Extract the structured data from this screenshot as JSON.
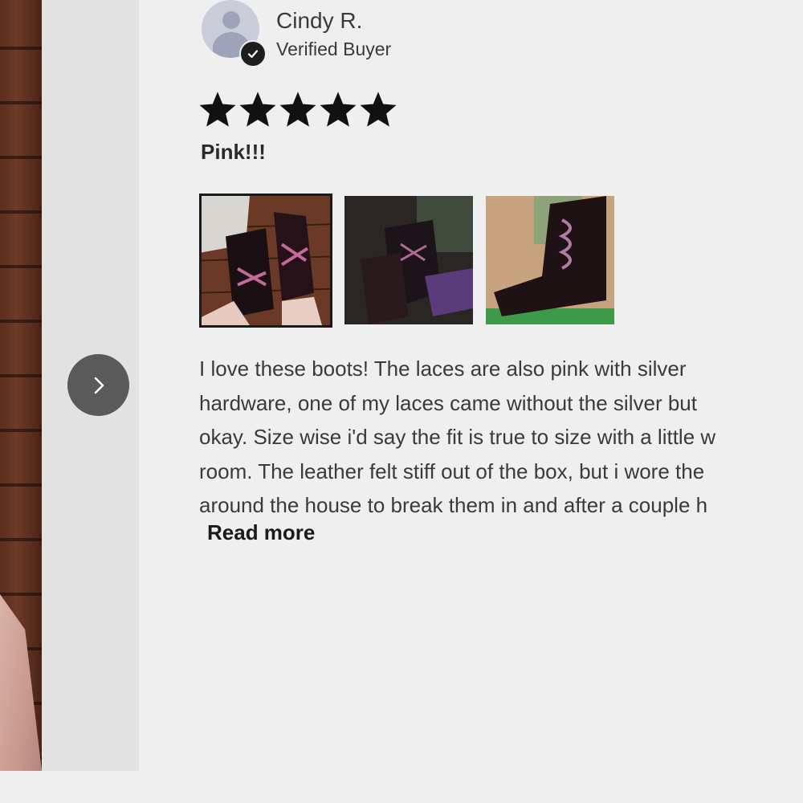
{
  "reviewer": {
    "name": "Cindy R.",
    "badge": "Verified Buyer",
    "avatar_icon": "user-avatar-icon",
    "badge_icon": "checkmark-icon"
  },
  "review": {
    "rating": 5,
    "rating_max": 5,
    "title": "Pink!!!",
    "body_lines": [
      "I love these boots! The laces are also pink with silver",
      "hardware, one of my laces came without the silver but",
      "okay. Size wise i'd say the fit is true to size with a little w",
      "room. The leather felt stiff out of the box, but i wore the",
      "around the house to break them in and after a couple h"
    ],
    "read_more": "Read more"
  },
  "carousel": {
    "next_icon": "chevron-right-icon"
  },
  "colors": {
    "background": "#efefef",
    "panel": "#e2e2e2",
    "next_button": "#5a5a5a",
    "text": "#3a3a3a",
    "star": "#111111"
  }
}
